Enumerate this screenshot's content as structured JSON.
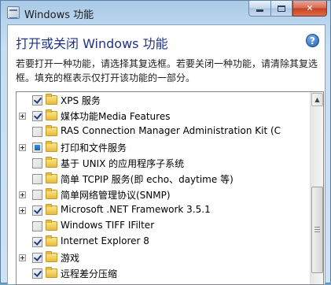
{
  "window": {
    "title": "Windows 功能",
    "buttons": {
      "minimize": "minimize",
      "maximize": "maximize",
      "close": "✕"
    }
  },
  "dialog": {
    "heading": "打开或关闭 Windows 功能",
    "help": "?",
    "description": "若要打开一种功能，请选择其复选框。若要关闭一种功能，请清除其复选框。填充的框表示仅打开该功能的一部分。"
  },
  "features": [
    {
      "label": "XPS 服务",
      "state": "checked",
      "expandable": false
    },
    {
      "label": "媒体功能Media Features",
      "state": "checked",
      "expandable": true
    },
    {
      "label": "RAS Connection Manager Administration Kit (C",
      "state": "unchecked",
      "expandable": false
    },
    {
      "label": "打印和文件服务",
      "state": "partial",
      "expandable": true
    },
    {
      "label": "基于 UNIX 的应用程序子系统",
      "state": "unchecked",
      "expandable": false
    },
    {
      "label": "简单 TCPIP 服务(即 echo、daytime 等)",
      "state": "unchecked",
      "expandable": false
    },
    {
      "label": "简单网络管理协议(SNMP)",
      "state": "unchecked",
      "expandable": true
    },
    {
      "label": "Microsoft .NET Framework 3.5.1",
      "state": "checked",
      "expandable": true
    },
    {
      "label": "Windows TIFF IFilter",
      "state": "unchecked",
      "expandable": false
    },
    {
      "label": "Internet Explorer 8",
      "state": "checked",
      "expandable": false
    },
    {
      "label": "游戏",
      "state": "checked",
      "expandable": true
    },
    {
      "label": "远程差分压缩",
      "state": "checked",
      "expandable": false
    }
  ],
  "icons": {
    "app": "windows-features-icon",
    "folder": "folder-icon",
    "help": "help-icon"
  },
  "colors": {
    "heading": "#1e3287",
    "close_button": "#c7421f",
    "title_bar": "#bcd6ee"
  }
}
